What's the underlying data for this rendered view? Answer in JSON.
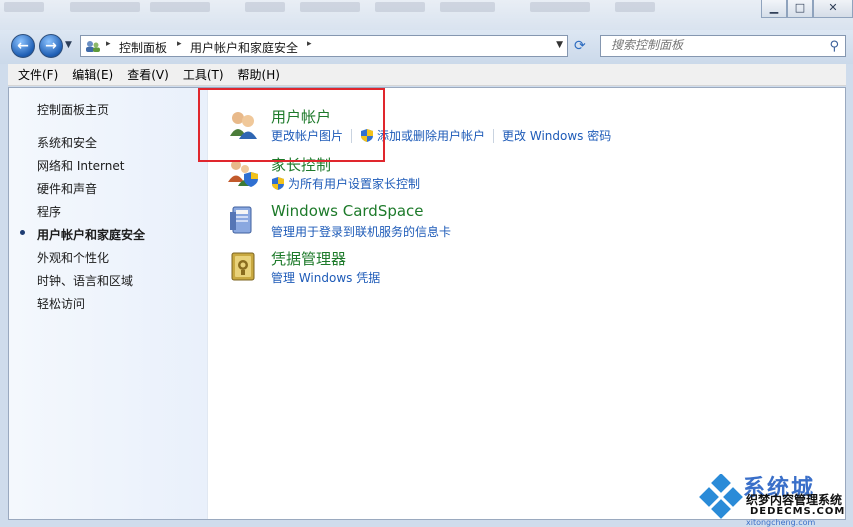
{
  "window": {
    "controls": {
      "minimize": "▁",
      "maximize": "□",
      "close": "✕"
    }
  },
  "address_bar": {
    "breadcrumbs": [
      "控制面板",
      "用户帐户和家庭安全"
    ],
    "search_placeholder": "搜索控制面板"
  },
  "menu": [
    "文件(F)",
    "编辑(E)",
    "查看(V)",
    "工具(T)",
    "帮助(H)"
  ],
  "sidebar": {
    "items": [
      {
        "label": "控制面板主页"
      },
      {
        "label": "系统和安全"
      },
      {
        "label": "网络和 Internet"
      },
      {
        "label": "硬件和声音"
      },
      {
        "label": "程序"
      },
      {
        "label": "用户帐户和家庭安全",
        "current": true
      },
      {
        "label": "外观和个性化"
      },
      {
        "label": "时钟、语言和区域"
      },
      {
        "label": "轻松访问"
      }
    ]
  },
  "categories": [
    {
      "title": "用户帐户",
      "icon": "user-accounts-icon",
      "links": [
        "更改帐户图片",
        "添加或删除用户帐户",
        "更改 Windows 密码"
      ]
    },
    {
      "title": "家长控制",
      "icon": "parental-controls-icon",
      "links": [
        "为所有用户设置家长控制"
      ]
    },
    {
      "title": "Windows CardSpace",
      "icon": "cardspace-icon",
      "links": [
        "管理用于登录到联机服务的信息卡"
      ]
    },
    {
      "title": "凭据管理器",
      "icon": "credential-manager-icon",
      "links": [
        "管理 Windows 凭据"
      ]
    }
  ],
  "watermark": {
    "brand": "系统城",
    "line1": "织梦内容管理系统",
    "line2": "DEDECMS.COM",
    "line3": "xitongcheng.com"
  },
  "colors": {
    "category_title": "#1d7a2a",
    "link": "#1e5bb8",
    "highlight": "#e0262d"
  }
}
